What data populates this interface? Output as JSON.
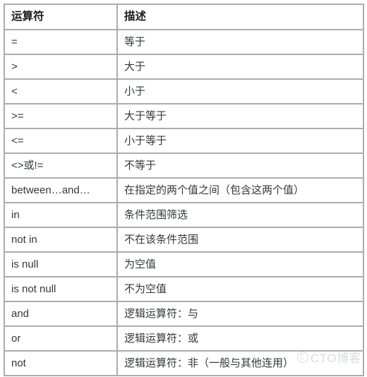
{
  "table": {
    "columns": [
      {
        "key": "operator",
        "label": "运算符"
      },
      {
        "key": "description",
        "label": "描述"
      }
    ],
    "rows": [
      {
        "operator": "=",
        "description": "等于"
      },
      {
        "operator": ">",
        "description": "大于"
      },
      {
        "operator": "<",
        "description": "小于"
      },
      {
        "operator": ">=",
        "description": "大于等于"
      },
      {
        "operator": "<=",
        "description": "小于等于"
      },
      {
        "operator": "<>或!=",
        "description": "不等于"
      },
      {
        "operator": "between…and…",
        "description": "在指定的两个值之间（包含这两个值）"
      },
      {
        "operator": "in",
        "description": "条件范围筛选"
      },
      {
        "operator": "not in",
        "description": "不在该条件范围"
      },
      {
        "operator": "is null",
        "description": "为空值"
      },
      {
        "operator": "is not null",
        "description": "不为空值"
      },
      {
        "operator": "and",
        "description": "逻辑运算符：与"
      },
      {
        "operator": "or",
        "description": "逻辑运算符：或"
      },
      {
        "operator": "not",
        "description": "逻辑运算符：非（一般与其他连用）"
      }
    ]
  },
  "watermark": {
    "icon": "copyright-icon",
    "text": "CTO博客"
  },
  "colors": {
    "border": "#acacac",
    "header_text": "#1a1c1f",
    "body_text": "#33373d",
    "background": "#ffffff",
    "watermark_text": "#d9dcdf"
  }
}
